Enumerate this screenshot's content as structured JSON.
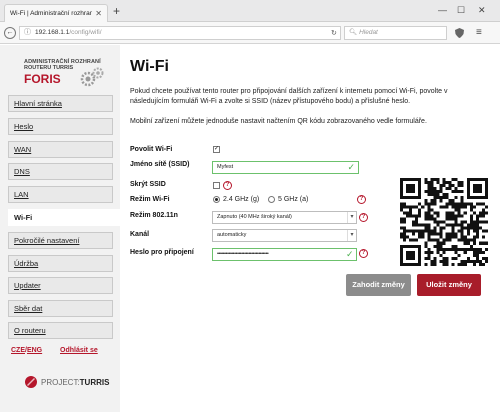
{
  "browser": {
    "tab_title": "Wi-Fi | Administrační rozhraní…",
    "url_host": "192.168.1.1",
    "url_path": "/config/wifi/",
    "search_placeholder": "Hledat"
  },
  "sidebar": {
    "logo_line1": "ADMINISTRAČNÍ ROZHRANÍ",
    "logo_line2": "ROUTERU TURRIS",
    "logo_line3": "FORIS",
    "items": [
      {
        "label": "Hlavní stránka"
      },
      {
        "label": "Heslo"
      },
      {
        "label": "WAN"
      },
      {
        "label": "DNS"
      },
      {
        "label": "LAN"
      },
      {
        "label": "Wi-Fi"
      },
      {
        "label": "Pokročilé nastavení"
      },
      {
        "label": "Údržba"
      },
      {
        "label": "Updater"
      },
      {
        "label": "Sběr dat"
      },
      {
        "label": "O routeru"
      }
    ],
    "lang_cze": "CZE",
    "lang_sep": "/",
    "lang_eng": "ENG",
    "logout": "Odhlásit se",
    "footer_project": "PROJECT:",
    "footer_turris": "TURRIS"
  },
  "main": {
    "title": "Wi-Fi",
    "description": "Pokud chcete používat tento router pro připojování dalších zařízení k internetu pomocí Wi-Fi, povolte v následujícím formuláři Wi-Fi a zvolte si SSID (název přístupového bodu) a příslušné heslo.",
    "qr_hint": "Mobilní zařízení můžete jednoduše nastavit načtením QR kódu zobrazovaného vedle formuláře.",
    "form": {
      "enable_label": "Povolit Wi-Fi",
      "ssid_label": "Jméno sítě (SSID)",
      "ssid_value": "Myfest",
      "hide_label": "Skrýt SSID",
      "mode_label": "Režim Wi-Fi",
      "mode_opt1": "2.4 GHz (g)",
      "mode_opt2": "5 GHz (a)",
      "n_label": "Režim 802.11n",
      "n_value": "Zapnuto (40 MHz široký kanál)",
      "channel_label": "Kanál",
      "channel_value": "automaticky",
      "password_label": "Heslo pro připojení",
      "password_value": "••••••••••••••••••••••••••••••••••••"
    },
    "discard_label": "Zahodit změny",
    "save_label": "Uložit změny"
  }
}
